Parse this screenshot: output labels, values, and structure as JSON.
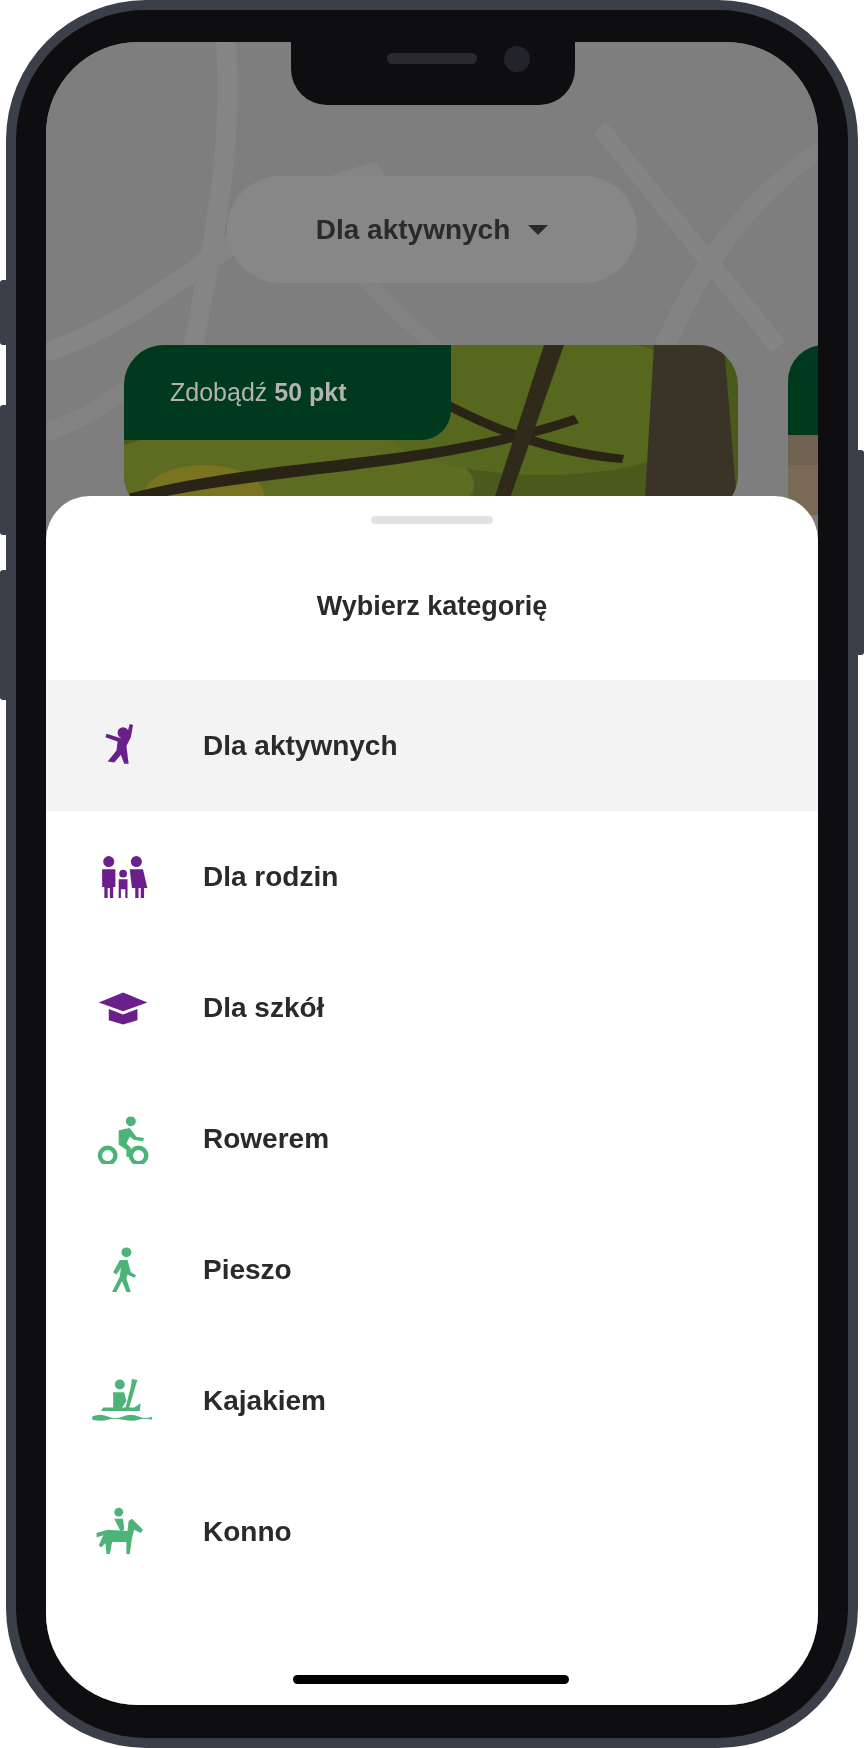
{
  "dropdown": {
    "label": "Dla aktywnych"
  },
  "cards": [
    {
      "badge": "Zdobądź **50 pkt**"
    },
    {
      "kind": "picture"
    }
  ],
  "sheet": {
    "title": "Wybierz kategorię",
    "items": [
      {
        "label": "Dla aktywnych",
        "selected": true,
        "color": "#6a1f8c"
      },
      {
        "label": "Dla rodzin",
        "selected": false,
        "color": "#6a1f8c"
      },
      {
        "label": "Dla szkół",
        "selected": false,
        "color": "#6a1f8c"
      },
      {
        "label": "Rowerem",
        "selected": false,
        "color": "#4cb477"
      },
      {
        "label": "Pieszo",
        "selected": false,
        "color": "#4cb477"
      },
      {
        "label": "Kajakiem",
        "selected": false,
        "color": "#4cb477"
      },
      {
        "label": "Konno",
        "selected": false,
        "color": "#4cb477"
      }
    ]
  }
}
